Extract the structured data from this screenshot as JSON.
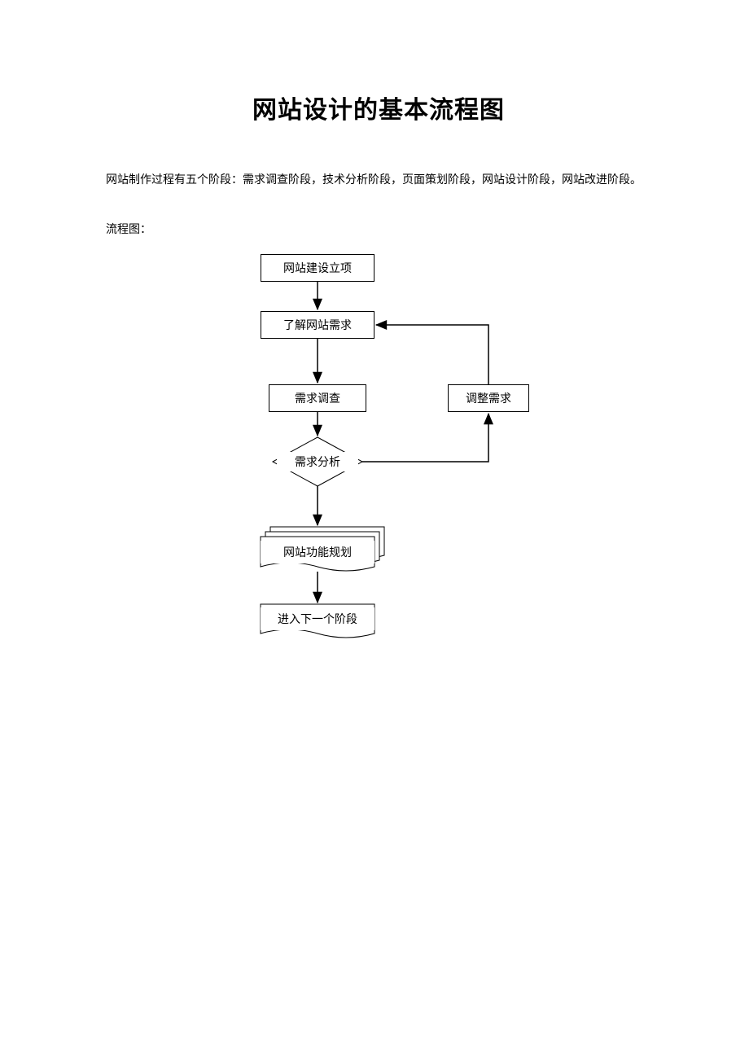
{
  "title": "网站设计的基本流程图",
  "paragraph": "网站制作过程有五个阶段：需求调查阶段，技术分析阶段，页面策划阶段，网站设计阶段，网站改进阶段。",
  "subhead": "流程图：",
  "nodes": {
    "start": "网站建设立项",
    "understand": "了解网站需求",
    "survey": "需求调查",
    "adjust": "调整需求",
    "analysis": "需求分析",
    "plan": "网站功能规划",
    "next": "进入下一个阶段"
  }
}
